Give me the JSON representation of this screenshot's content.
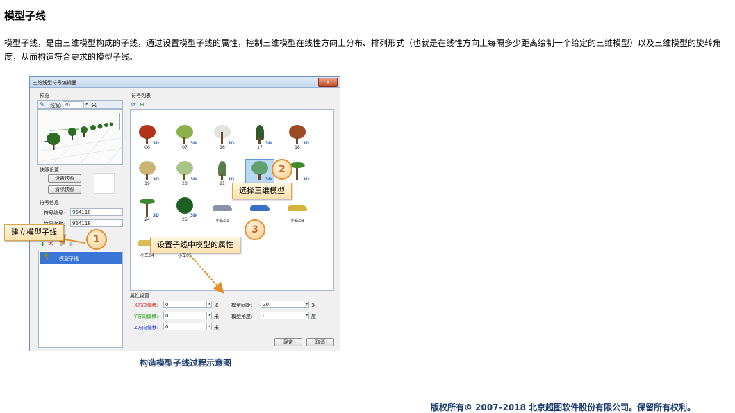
{
  "page": {
    "title": "模型子线",
    "paragraph": "模型子线，是由三维模型构成的子线，通过设置模型子线的属性，控制三维模型在线性方向上分布、排列形式（也就是在线性方向上每隔多少距离绘制一个给定的三维模型）以及三维模型的旋转角度，从而构造符合要求的模型子线。",
    "caption": "构造模型子线过程示意图",
    "footer": "版权所有© 2007–2018 北京超图软件股份有限公司。保留所有权利。"
  },
  "window": {
    "title": "三维线型符号编辑器",
    "close": "x",
    "preview": {
      "header": "预览",
      "linewidth_label": "线宽:",
      "linewidth_value": "20",
      "unit": "米"
    },
    "snapshot": {
      "header": "快照设置",
      "set_button": "设置快照",
      "clear_button": "清除快照"
    },
    "symbol_info": {
      "header": "符号信息",
      "id_label": "符号编号:",
      "id_value": "964118",
      "name_label": "符号名称:",
      "name_value": "964118"
    },
    "subline_list": {
      "items": [
        "模型子线"
      ]
    },
    "symbol_list": {
      "header": "符号列表",
      "rows": [
        [
          "06",
          "07",
          "16",
          "17",
          "18"
        ],
        [
          "19",
          "20",
          "21",
          "",
          ""
        ],
        [
          "24",
          "25",
          "小车01",
          "",
          "小车03"
        ],
        [
          "小车04",
          "小车05"
        ]
      ]
    },
    "properties": {
      "header": "属性设置",
      "x_offset_label": "X方向偏移:",
      "x_offset_value": "0",
      "y_offset_label": "Y方向偏移:",
      "y_offset_value": "0",
      "z_offset_label": "Z方向偏移:",
      "z_offset_value": "0",
      "unit_m": "米",
      "spacing_label": "模型间距:",
      "spacing_value": "20",
      "angle_label": "模型角度:",
      "angle_value": "0",
      "unit_deg": "度"
    },
    "ok": "确定",
    "cancel": "取消"
  },
  "callouts": [
    {
      "number": "1",
      "text": "建立模型子线"
    },
    {
      "number": "2",
      "text": "选择三维模型"
    },
    {
      "number": "3",
      "text": "设置子线中模型的属性"
    }
  ],
  "icons": [
    "close-icon",
    "refresh-icon",
    "add-icon",
    "delete-icon",
    "tree-icon",
    "car-icon"
  ],
  "colors": {
    "x_label": "#d02020",
    "y_label": "#18a018",
    "z_label": "#2040d0",
    "callout_border": "#d9a44f",
    "arrow": "#e2912e",
    "caption": "#1c3d6e"
  }
}
